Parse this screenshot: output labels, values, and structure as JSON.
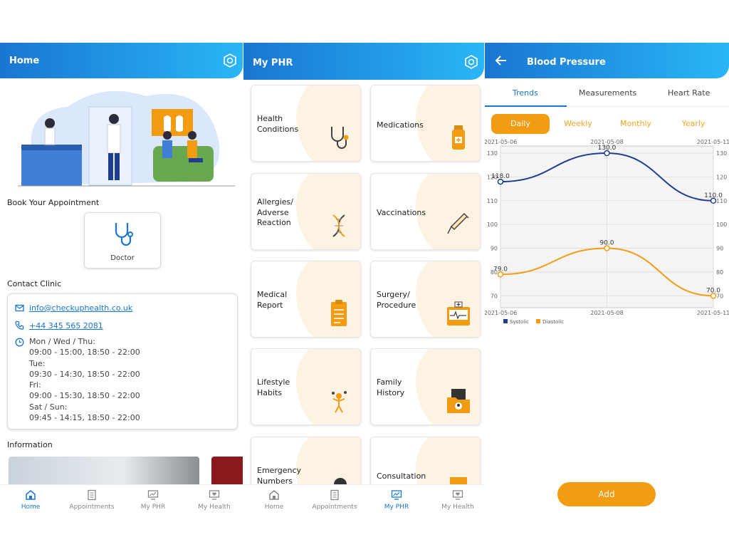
{
  "home": {
    "title": "Home",
    "book_heading": "Book Your Appointment",
    "doctor_label": "Doctor",
    "contact_heading": "Contact Clinic",
    "email": "info@checkuphealth.co.uk",
    "phone": "+44 345 565 2081",
    "hours": [
      "Mon / Wed / Thu:",
      "09:00 - 15:00, 18:50 - 22:00",
      "Tue:",
      "09:30 - 14:30, 18:50 - 22:00",
      "Fri:",
      "09:00 - 15:30, 18:50 - 22:00",
      "Sat / Sun:",
      "09:45 - 14:15, 18:50 - 22:00"
    ],
    "information_heading": "Information",
    "nav": [
      "Home",
      "Appointments",
      "My PHR",
      "My Health"
    ],
    "nav_active": "Home"
  },
  "phr": {
    "title": "My PHR",
    "cards": [
      {
        "label": "Health\nConditions",
        "icon": "stethoscope-icon"
      },
      {
        "label": "Medications",
        "icon": "medicine-bottle-icon"
      },
      {
        "label": "Allergies/\nAdverse\nReaction",
        "icon": "dna-icon"
      },
      {
        "label": "Vaccinations",
        "icon": "syringe-icon"
      },
      {
        "label": "Medical\nReport",
        "icon": "clipboard-icon"
      },
      {
        "label": "Surgery/\nProcedure",
        "icon": "heart-monitor-icon"
      },
      {
        "label": "Lifestyle\nHabits",
        "icon": "lifestyle-icon"
      },
      {
        "label": "Family\nHistory",
        "icon": "folder-icon"
      },
      {
        "label": "Emergency\nNumbers",
        "icon": "emergency-icon"
      },
      {
        "label": "Consultation",
        "icon": "consultation-icon"
      }
    ],
    "nav": [
      "Home",
      "Appointments",
      "My PHR",
      "My Health"
    ],
    "nav_active": "My PHR"
  },
  "bp": {
    "title": "Blood Pressure",
    "tabs": [
      "Trends",
      "Measurements",
      "Heart Rate"
    ],
    "active_tab": "Trends",
    "periods": [
      "Daily",
      "Weekly",
      "Monthly",
      "Yearly"
    ],
    "active_period": "Daily",
    "add_label": "Add"
  },
  "chart_data": {
    "type": "line",
    "x": [
      "2021-05-06",
      "2021-05-08",
      "2021-05-11"
    ],
    "series": [
      {
        "name": "Systolic",
        "values": [
          118.0,
          130.0,
          110.0
        ],
        "color": "#1e3f8f"
      },
      {
        "name": "Diastolic",
        "values": [
          79.0,
          90.0,
          70.0
        ],
        "color": "#f39c12"
      }
    ],
    "point_labels": {
      "Systolic": [
        "118.0",
        "130.0",
        "110.0"
      ],
      "Diastolic": [
        "79.0",
        "90.0",
        "70.0"
      ]
    },
    "yticks": [
      70,
      80,
      90,
      100,
      110,
      120,
      130
    ],
    "ylim": [
      65,
      133
    ],
    "grid": true,
    "legend": "bottom-left"
  },
  "colors": {
    "primary": "#1976d2",
    "accent": "#f39c12",
    "card_tint": "#fdf3e3"
  }
}
